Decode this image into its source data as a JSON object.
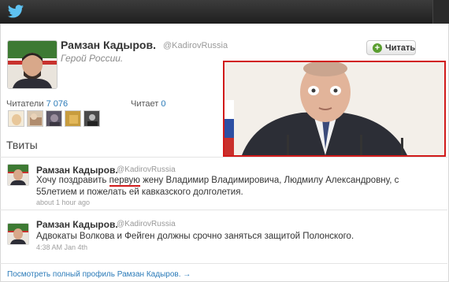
{
  "app": {
    "name": "Twitter"
  },
  "profile": {
    "name": "Рамзан Кадыров.",
    "handle": "@KadirovRussia",
    "bio": "Герой России.",
    "follow_label": "Читать",
    "followers_label": "Читатели",
    "followers_count": "7 076",
    "following_label": "Читает",
    "following_count": "0"
  },
  "tweets_title": "Твиты",
  "tweets": [
    {
      "name": "Рамзан Кадыров.",
      "handle": "@KadirovRussia",
      "text_before": "Хочу поздравить ",
      "text_highlight": "первую",
      "text_after": " жену Владимир Владимировича, Людмилу Александровну, с 55летием и пожелать ей кавказского долголетия.",
      "time": "about 1 hour ago"
    },
    {
      "name": "Рамзан Кадыров.",
      "handle": "@KadirovRussia",
      "text": "Адвокаты Волкова и Фейген должны срочно заняться защитой Полонского.",
      "time": "4:38 AM Jan 4th"
    }
  ],
  "footer_link": "Посмотреть полный профиль Рамзан Кадыров. →",
  "colors": {
    "link": "#2a7ab8",
    "highlight_border": "#d11a1a",
    "topbar": "#2b2b2b"
  }
}
